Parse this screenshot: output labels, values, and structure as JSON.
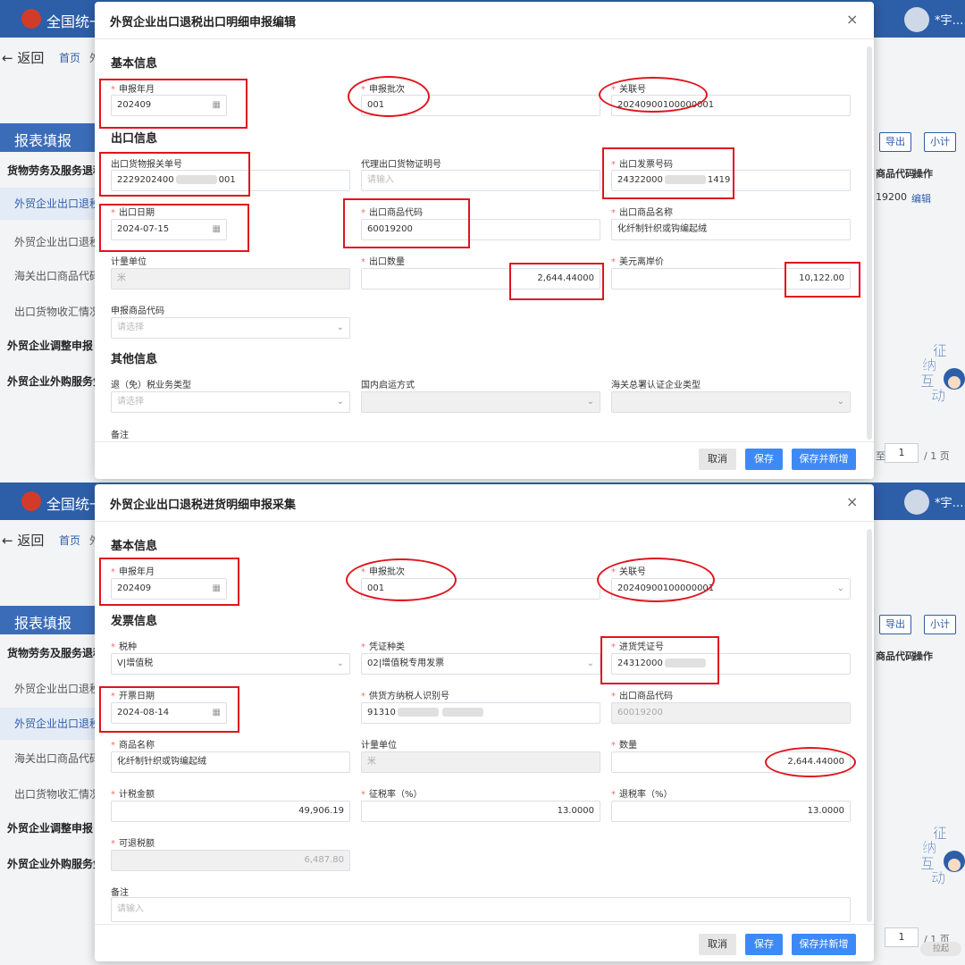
{
  "background_app": {
    "title": "全国统一",
    "user_name": "*宇…",
    "back_label": "返回",
    "breadcrumb_home": "首页",
    "breadcrumb_next": "外",
    "sidebar_header": "报表填报",
    "sidebar_items": [
      "货物劳务及服务退税...",
      "外贸企业出口退税出",
      "外贸企业出口退税进",
      "海关出口商品代码、",
      "出口货物收汇情况表",
      "外贸企业调整申报",
      "外贸企业外购服务免..."
    ],
    "btn_export": "导出",
    "btn_small": "小计",
    "th_code": "商品代码",
    "th_op": "操作",
    "row_code": "19200",
    "row_edit": "编辑",
    "pager_prefix": "至",
    "pager_value": "1",
    "pager_total": "/ 1 页",
    "mascot_text": [
      "征",
      "纳",
      "互",
      "动"
    ],
    "mascot_badge": "拉起"
  },
  "panel1": {
    "title": "外贸企业出口退税出口明细申报编辑",
    "close": "×",
    "section_basic": "基本信息",
    "section_export": "出口信息",
    "section_other": "其他信息",
    "fields": {
      "report_month_label": "申报年月",
      "report_month_value": "202409",
      "batch_label": "申报批次",
      "batch_value": "001",
      "assoc_label": "关联号",
      "assoc_value": "20240900100000001",
      "customs_no_label": "出口货物报关单号",
      "customs_no_prefix": "2229202400",
      "customs_no_suffix": "001",
      "agent_cert_label": "代理出口货物证明号",
      "agent_cert_placeholder": "请输入",
      "invoice_no_label": "出口发票号码",
      "invoice_no_prefix": "24322000",
      "invoice_no_suffix": "1419",
      "export_date_label": "出口日期",
      "export_date_value": "2024-07-15",
      "goods_code_label": "出口商品代码",
      "goods_code_value": "60019200",
      "goods_name_label": "出口商品名称",
      "goods_name_value": "化纤制针织或钩编起绒",
      "unit_label": "计量单位",
      "unit_value": "米",
      "qty_label": "出口数量",
      "qty_value": "2,644.44000",
      "usd_price_label": "美元离岸价",
      "usd_price_value": "10,122.00",
      "decl_code_label": "申报商品代码",
      "decl_code_placeholder": "请选择",
      "tax_type_label": "退（免）税业务类型",
      "tax_type_placeholder": "请选择",
      "domestic_transport_label": "国内启运方式",
      "customs_cert_label": "海关总署认证企业类型",
      "remark_label": "备注"
    },
    "buttons": {
      "cancel": "取消",
      "save": "保存",
      "save_new": "保存并新增"
    }
  },
  "panel2": {
    "title": "外贸企业出口退税进货明细申报采集",
    "close": "×",
    "section_basic": "基本信息",
    "section_invoice": "发票信息",
    "fields": {
      "report_month_label": "申报年月",
      "report_month_value": "202409",
      "batch_label": "申报批次",
      "batch_value": "001",
      "assoc_label": "关联号",
      "assoc_value": "20240900100000001",
      "tax_kind_label": "税种",
      "tax_kind_value": "V|增值税",
      "voucher_type_label": "凭证种类",
      "voucher_type_value": "02|增值税专用发票",
      "purchase_voucher_label": "进货凭证号",
      "purchase_voucher_prefix": "24312000",
      "invoice_date_label": "开票日期",
      "invoice_date_value": "2024-08-14",
      "supplier_id_label": "供货方纳税人识别号",
      "supplier_id_prefix": "91310",
      "export_code_label": "出口商品代码",
      "export_code_value": "60019200",
      "goods_name_label": "商品名称",
      "goods_name_value": "化纤制针织或钩编起绒",
      "unit_label": "计量单位",
      "unit_value": "米",
      "qty_label": "数量",
      "qty_value": "2,644.44000",
      "tax_amount_label": "计税金额",
      "tax_amount_value": "49,906.19",
      "levy_rate_label": "征税率（%）",
      "levy_rate_value": "13.0000",
      "refund_rate_label": "退税率（%）",
      "refund_rate_value": "13.0000",
      "refundable_label": "可退税额",
      "refundable_value": "6,487.80",
      "remark_label": "备注",
      "remark_placeholder": "请输入"
    },
    "buttons": {
      "cancel": "取消",
      "save": "保存",
      "save_new": "保存并新增"
    }
  },
  "colors": {
    "brand": "#2d5ea8",
    "primary_button": "#3d8af7",
    "required": "#f56c6c",
    "annotation": "#e0141e"
  },
  "icons": [
    "calendar-icon",
    "chevron-down-icon",
    "close-icon",
    "back-arrow-icon"
  ]
}
